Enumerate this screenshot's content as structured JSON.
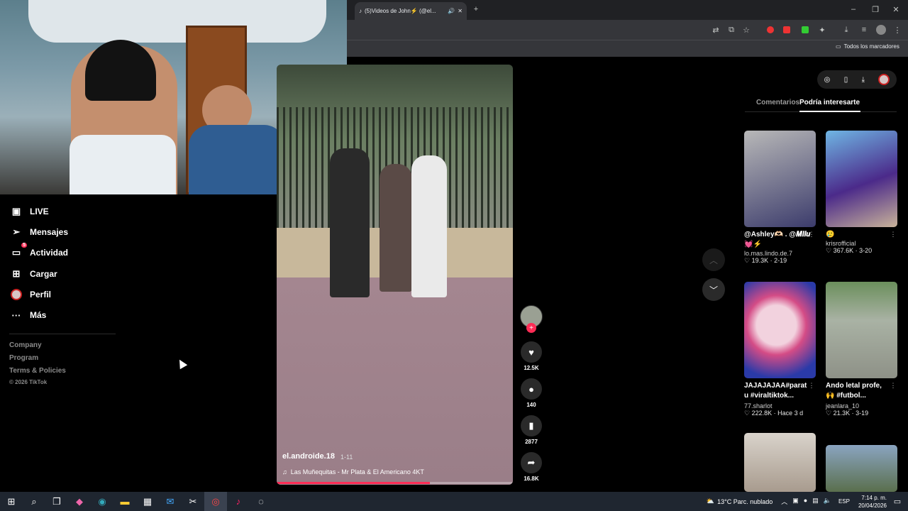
{
  "browser": {
    "tab_title": "(5)Videos de John⚡ (@el...",
    "bookmarks_label": "Todos los marcadores"
  },
  "sidebar": {
    "items": [
      {
        "label": "LIVE",
        "icon": "live-icon"
      },
      {
        "label": "Mensajes",
        "icon": "messages-icon"
      },
      {
        "label": "Actividad",
        "icon": "activity-icon",
        "badge": "5"
      },
      {
        "label": "Cargar",
        "icon": "upload-icon"
      },
      {
        "label": "Perfil",
        "icon": "profile-avatar-icon"
      },
      {
        "label": "Más",
        "icon": "more-icon"
      }
    ],
    "footer": [
      "Company",
      "Program",
      "Terms & Policies",
      "© 2026 TikTok"
    ]
  },
  "video": {
    "author": "el.androide.18",
    "date": "1-11",
    "music": "Las Muñequitas - Mr Plata & El Americano 4KT",
    "progress": 0.65
  },
  "actions": {
    "likes": "12.5K",
    "comments": "140",
    "saves": "2877",
    "shares": "16.8K"
  },
  "right_panel": {
    "tabs": [
      "Comentarios",
      "Podría interesarte"
    ],
    "active_tab": "Podría interesarte",
    "cards": [
      {
        "caption": "@Ashley🫶🏻 . @𝑴𝒊𝒍𝒖💓⚡",
        "user": "lo.mas.lindo.de.7",
        "likes": "19.3K",
        "date": "2-19"
      },
      {
        "caption": "🥲",
        "user": "krisrofficial",
        "likes": "367.6K",
        "date": "3-20"
      },
      {
        "caption": "JAJAJAJAA#parat u #viraltiktok...",
        "user": "77.sharlot",
        "likes": "222.8K",
        "date": "Hace 3 d"
      },
      {
        "caption": "Ando letal profe, 🙌 #futbol...",
        "user": "jeanlara_10",
        "likes": "21.3K",
        "date": "3-19"
      }
    ]
  },
  "taskbar": {
    "weather": "13°C  Parc. nublado",
    "lang": "ESP",
    "time": "7:14 p. m.",
    "date": "20/04/2026"
  },
  "colors": {
    "accent": "#fe2c55",
    "bg": "#000000",
    "taskbar": "#1f2630"
  }
}
